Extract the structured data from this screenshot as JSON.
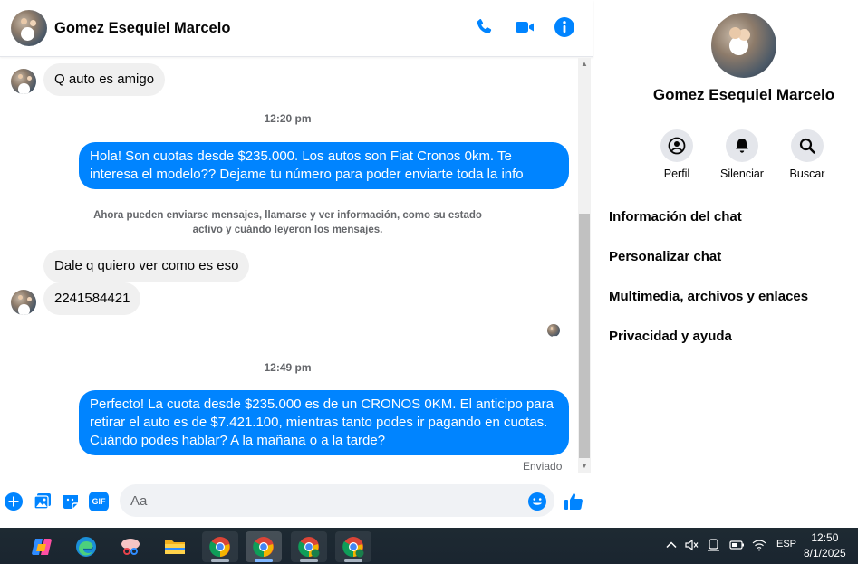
{
  "chat": {
    "contact_name": "Gomez Esequiel Marcelo",
    "header_icons": [
      "phone-icon",
      "video-icon",
      "info-icon"
    ],
    "messages": {
      "in1": "Q auto es amigo",
      "ts1": "12:20 pm",
      "out1": "Hola! Son cuotas desde $235.000. Los autos son Fiat Cronos 0km. Te interesa el modelo?? Dejame tu número para poder enviarte toda la info",
      "notice": "Ahora pueden enviarse mensajes, llamarse y ver información, como su estado activo y cuándo leyeron los mensajes.",
      "in2": "Dale q quiero ver como es eso",
      "in3": "2241584421",
      "ts2": "12:49 pm",
      "out2": "Perfecto! La cuota desde $235.000 es de un CRONOS 0KM. El anticipo para retirar el auto es de $7.421.100, mientras tanto podes ir pagando en cuotas. Cuándo podes hablar? A la mañana o a la tarde?",
      "status": "Enviado"
    },
    "composer": {
      "placeholder": "Aa",
      "icons": [
        "plus-icon",
        "image-icon",
        "sticker-icon",
        "gif-icon",
        "emoji-icon",
        "like-icon"
      ],
      "gif_label": "GIF"
    },
    "accent": "#0084ff"
  },
  "sidebar": {
    "name": "Gomez Esequiel Marcelo",
    "actions": [
      {
        "label": "Perfil",
        "icon": "profile-icon"
      },
      {
        "label": "Silenciar",
        "icon": "bell-icon"
      },
      {
        "label": "Buscar",
        "icon": "search-icon"
      }
    ],
    "menu": [
      "Información del chat",
      "Personalizar chat",
      "Multimedia, archivos y enlaces",
      "Privacidad y ayuda"
    ]
  },
  "taskbar": {
    "language": "ESP",
    "time": "12:50",
    "date": "8/1/2025"
  }
}
